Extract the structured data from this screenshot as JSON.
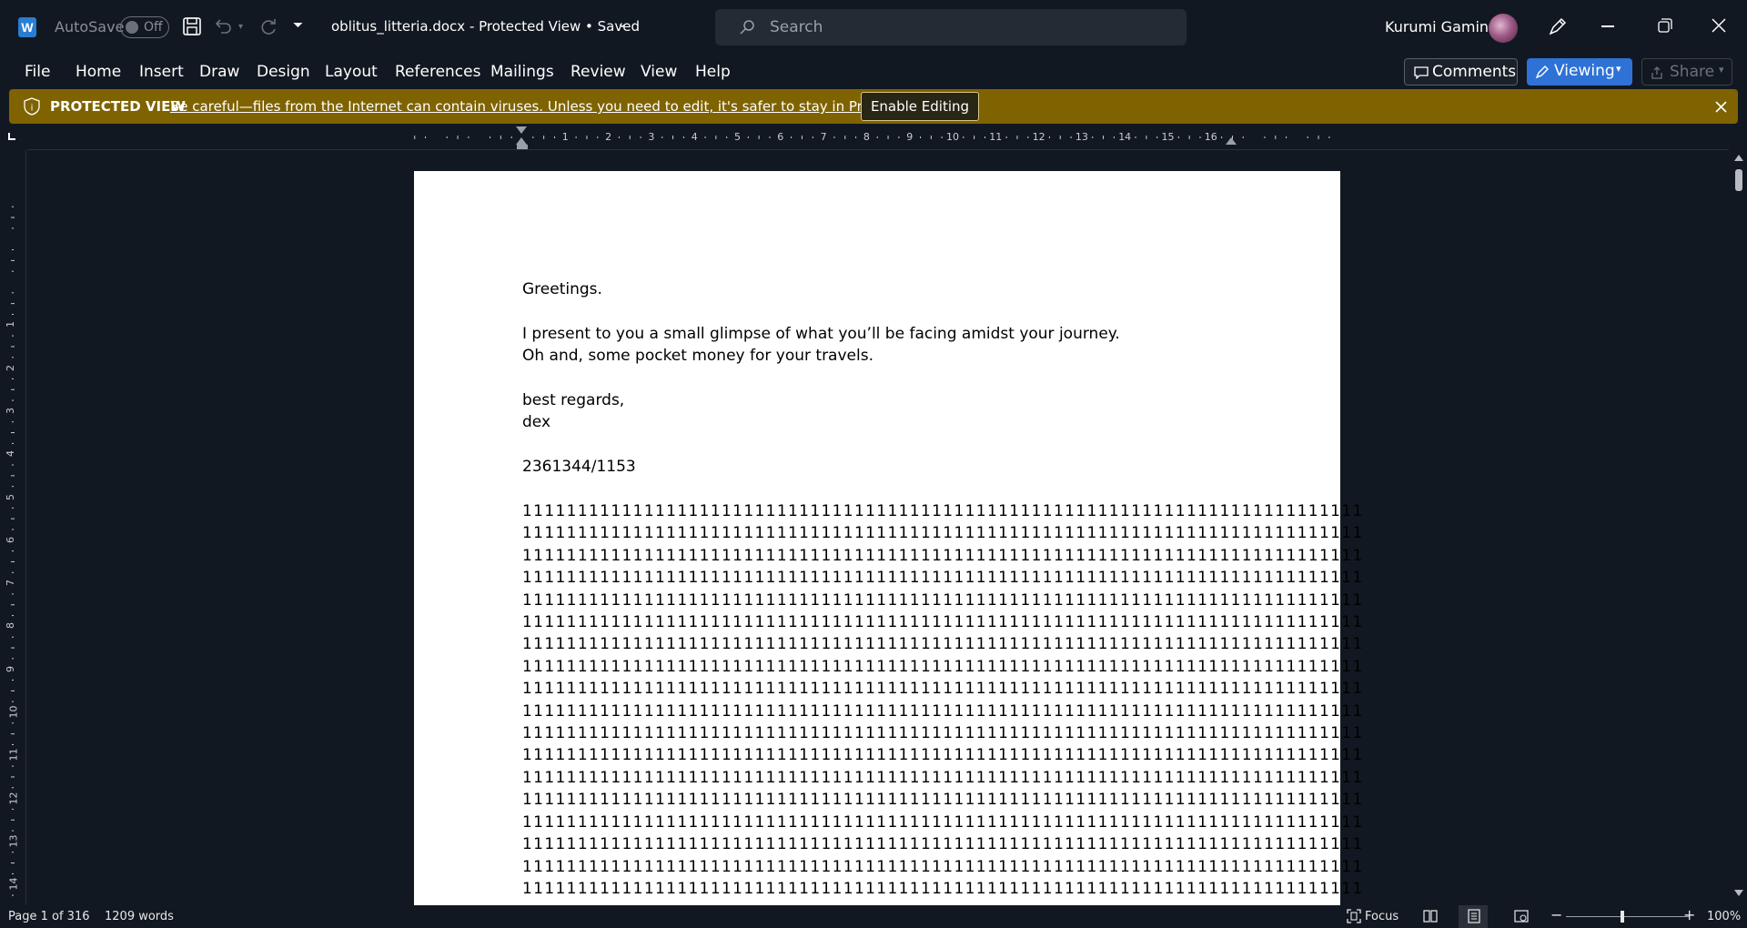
{
  "titlebar": {
    "app_icon": "word-icon",
    "autosave_label": "AutoSave",
    "autosave_state": "Off",
    "doc_title": "oblitus_litteria.docx  -  Protected View • Saved",
    "search_placeholder": "Search",
    "user_name": "Kurumi Gaming"
  },
  "menu": {
    "items": [
      "File",
      "Home",
      "Insert",
      "Draw",
      "Design",
      "Layout",
      "References",
      "Mailings",
      "Review",
      "View",
      "Help"
    ],
    "comments_label": "Comments",
    "viewing_label": "Viewing",
    "share_label": "Share"
  },
  "protected_view": {
    "title": "PROTECTED VIEW",
    "message": "Be careful—files from the Internet can contain viruses. Unless you need to edit, it's safer to stay in Protected View.",
    "enable_label": "Enable Editing"
  },
  "ruler": {
    "h_numbers": [
      "1",
      "2",
      "3",
      "4",
      "5",
      "6",
      "7",
      "8",
      "9",
      "10",
      "11",
      "12",
      "13",
      "14",
      "15",
      "16"
    ],
    "v_numbers": [
      "1",
      "2",
      "3",
      "4",
      "5",
      "6",
      "7",
      "8",
      "9",
      "10",
      "11",
      "12",
      "13",
      "14"
    ]
  },
  "document": {
    "greeting": "Greetings.",
    "line1": "I present to you a small glimpse of what you’ll be facing amidst your journey.",
    "line2": "Oh and, some pocket money for your travels.",
    "closing": "best regards,",
    "signature": "dex",
    "code": "2361344/1153",
    "ones_lines": [
      "1111111111111111111111111111111111111111111111111111111111111111111111111111",
      "1111111111111111111111111111111111111111111111111111111111111111111111111111",
      "1111111111111111111111111111111111111111111111111111111111111111111111111111",
      "1111111111111111111111111111111111111111111111111111111111111111111111111111",
      "1111111111111111111111111111111111111111111111111111111111111111111111111111",
      "1111111111111111111111111111111111111111111111111111111111111111111111111111",
      "1111111111111111111111111111111111111111111111111111111111111111111111111111",
      "1111111111111111111111111111111111111111111111111111111111111111111111111111",
      "1111111111111111111111111111111111111111111111111111111111111111111111111111",
      "1111111111111111111111111111111111111111111111111111111111111111111111111111",
      "1111111111111111111111111111111111111111111111111111111111111111111111111111",
      "1111111111111111111111111111111111111111111111111111111111111111111111111111",
      "1111111111111111111111111111111111111111111111111111111111111111111111111111",
      "1111111111111111111111111111111111111111111111111111111111111111111111111111",
      "1111111111111111111111111111111111111111111111111111111111111111111111111111",
      "1111111111111111111111111111111111111111111111111111111111111111111111111111",
      "1111111111111111111111111111111111111111111111111111111111111111111111111111",
      "1111111111111111111111111111111111111111111111111111111111111111111111111111"
    ]
  },
  "status": {
    "page": "Page 1 of 316",
    "words": "1209 words",
    "focus_label": "Focus",
    "zoom": "100%"
  },
  "colors": {
    "background": "#121821",
    "protected_bar": "#7f6301",
    "viewing_accent": "#2e72d6",
    "word_blue": "#2b7cd3"
  }
}
